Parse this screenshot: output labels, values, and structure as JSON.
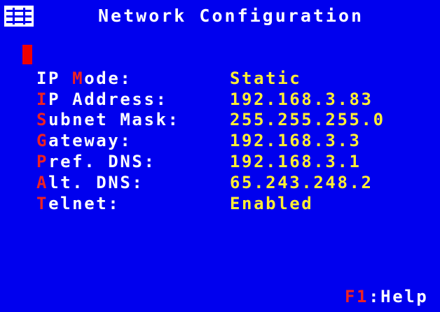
{
  "title": "Network Configuration",
  "fields": [
    {
      "hot": "M",
      "label_pre": "IP ",
      "label_post": "ode:",
      "value": "Static"
    },
    {
      "hot": "I",
      "label_pre": "",
      "label_post": "P Address:",
      "value": "192.168.3.83"
    },
    {
      "hot": "S",
      "label_pre": "",
      "label_post": "ubnet Mask:",
      "value": "255.255.255.0"
    },
    {
      "hot": "G",
      "label_pre": "",
      "label_post": "ateway:",
      "value": "192.168.3.3"
    },
    {
      "hot": "P",
      "label_pre": "",
      "label_post": "ref. DNS:",
      "value": "192.168.3.1"
    },
    {
      "hot": "A",
      "label_pre": "",
      "label_post": "lt. DNS:",
      "value": "65.243.248.2"
    },
    {
      "hot": "T",
      "label_pre": "",
      "label_post": "elnet:",
      "value": "Enabled"
    }
  ],
  "help": {
    "key": "F1",
    "text": ":Help"
  },
  "colors": {
    "background": "#0000ee",
    "label": "#ffffff",
    "value": "#ffee33",
    "hotkey": "#ee2222",
    "cursor": "#ee0000"
  },
  "icons": {
    "menu": "menu-grid-icon"
  }
}
